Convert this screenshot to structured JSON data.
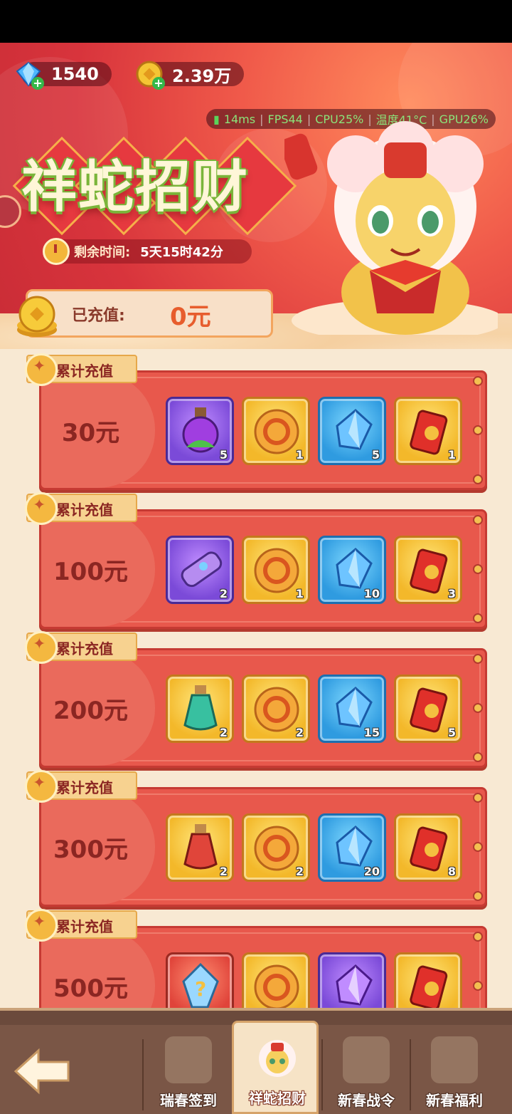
{
  "currencies": {
    "gems": "1540",
    "gold": "2.39万"
  },
  "perf_overlay": {
    "ping": "14ms",
    "fps": "FPS44",
    "cpu": "CPU25%",
    "temp": "温度41°C",
    "gpu": "GPU26%"
  },
  "event": {
    "title": "祥蛇招财",
    "timer_label": "剩余时间:",
    "timer_value": "5天15时42分",
    "recharged_label": "已充值:",
    "recharged_value": "0元"
  },
  "tiers": [
    {
      "tag": "累计充值",
      "amount": "30元",
      "items": [
        {
          "icon": "purple-potion-icon",
          "color": "purple",
          "count": "5"
        },
        {
          "icon": "gold-coin-icon",
          "color": "gold",
          "count": "1"
        },
        {
          "icon": "blue-diamond-icon",
          "color": "blue",
          "count": "5"
        },
        {
          "icon": "red-envelope-can-icon",
          "color": "gold",
          "count": "1"
        }
      ]
    },
    {
      "tag": "累计充值",
      "amount": "100元",
      "items": [
        {
          "icon": "purple-capsule-icon",
          "color": "purple",
          "count": "2"
        },
        {
          "icon": "gold-coin-icon",
          "color": "gold",
          "count": "1"
        },
        {
          "icon": "blue-diamond-icon",
          "color": "blue",
          "count": "10"
        },
        {
          "icon": "red-envelope-can-icon",
          "color": "gold",
          "count": "3"
        }
      ]
    },
    {
      "tag": "累计充值",
      "amount": "200元",
      "items": [
        {
          "icon": "green-potion-icon",
          "color": "gold",
          "count": "2"
        },
        {
          "icon": "gold-coin-icon",
          "color": "gold",
          "count": "2"
        },
        {
          "icon": "blue-diamond-icon",
          "color": "blue",
          "count": "15"
        },
        {
          "icon": "red-envelope-can-icon",
          "color": "gold",
          "count": "5"
        }
      ]
    },
    {
      "tag": "累计充值",
      "amount": "300元",
      "items": [
        {
          "icon": "red-potion-icon",
          "color": "gold",
          "count": "2"
        },
        {
          "icon": "gold-coin-icon",
          "color": "gold",
          "count": "2"
        },
        {
          "icon": "blue-diamond-icon",
          "color": "blue",
          "count": "20"
        },
        {
          "icon": "red-envelope-can-icon",
          "color": "gold",
          "count": "8"
        }
      ]
    },
    {
      "tag": "累计充值",
      "amount": "500元",
      "items": [
        {
          "icon": "mystery-crystal-icon",
          "color": "red",
          "count": ""
        },
        {
          "icon": "gold-coin-icon",
          "color": "gold",
          "count": ""
        },
        {
          "icon": "purple-crystal-icon",
          "color": "purple",
          "count": ""
        },
        {
          "icon": "red-envelope-can-icon",
          "color": "gold",
          "count": ""
        }
      ]
    }
  ],
  "nav": {
    "tabs": [
      {
        "label": "瑞春签到",
        "icon": "calendar-checkin-icon"
      },
      {
        "label": "祥蛇招财",
        "icon": "lion-mascot-icon"
      },
      {
        "label": "新春战令",
        "icon": "battle-pass-icon"
      },
      {
        "label": "新春福利",
        "icon": "gift-bowl-icon"
      }
    ]
  },
  "colors": {
    "header_red": "#d8343c",
    "card_red": "#e8584c",
    "cream": "#f8e9d3",
    "accent_gold": "#f3b82a"
  }
}
